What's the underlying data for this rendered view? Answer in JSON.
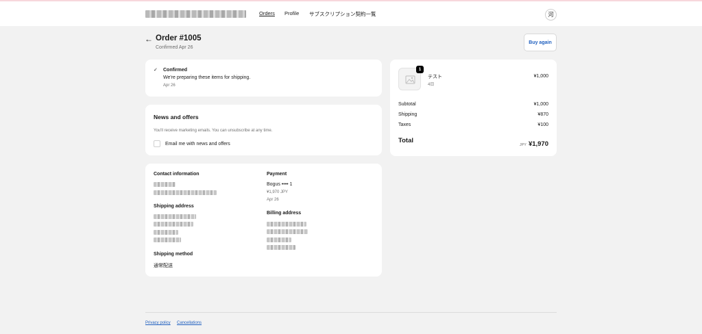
{
  "header": {
    "nav": [
      "Orders",
      "Profile",
      "サブスクリプション契約一覧"
    ],
    "avatar_initial": "河"
  },
  "order": {
    "back_icon": "←",
    "title": "Order #1005",
    "subtitle": "Confirmed Apr 26",
    "buy_again": "Buy again"
  },
  "status": {
    "check_icon": "✓",
    "title": "Confirmed",
    "message": "We're preparing these items for shipping.",
    "date": "Apr 26"
  },
  "news": {
    "title": "News and offers",
    "description": "You'll receive marketing emails. You can unsubscribe at any time.",
    "checkbox_label": "Email me with news and offers"
  },
  "details": {
    "contact_title": "Contact information",
    "payment_title": "Payment",
    "payment_method": "Bogus •••• 1",
    "payment_amount": "¥1,970 JPY",
    "payment_date": "Apr 26",
    "shipping_address_title": "Shipping address",
    "billing_address_title": "Billing address",
    "shipping_method_title": "Shipping method",
    "shipping_method": "通常配送"
  },
  "summary": {
    "item_quantity": "1",
    "item_name": "テスト",
    "item_variant": "4日",
    "item_price": "¥1,000",
    "subtotal_label": "Subtotal",
    "subtotal_value": "¥1,000",
    "shipping_label": "Shipping",
    "shipping_value": "¥870",
    "taxes_label": "Taxes",
    "taxes_value": "¥100",
    "total_label": "Total",
    "currency": "JPY",
    "total_value": "¥1,970"
  },
  "footer": {
    "links": [
      "Privacy policy",
      "Cancellations"
    ]
  },
  "colors": {
    "accent": "#1f5fbf",
    "background": "#f2f2f2"
  }
}
